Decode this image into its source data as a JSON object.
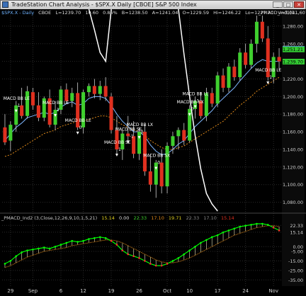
{
  "window": {
    "title": "TradeStation Chart Analysis - $SPX.X Daily [CBOE] S&P 500 Index",
    "buttons": [
      "_",
      "□",
      "✕"
    ]
  },
  "quote_bar": {
    "symbol": "$SPX.X - Daily",
    "exchange": "CBOE",
    "last": "L=1239.70",
    "change": "10.60",
    "pct": "0.86%",
    "bid": "B=1238.50",
    "ask": "A=1241.04",
    "open": "O=1229.59",
    "high": "Hi=1246.22",
    "low": "Lo=1227.70",
    "volume": "V=3,041,607",
    "study": "_PMACD_Ind1(1..."
  },
  "indicator2": {
    "title": "_PMACD_Ind2 (3,Close,12,26,9,10,1,5,21)",
    "values": [
      "15.14",
      "0.00",
      "22.33",
      "17.10",
      "19.71",
      "22.33",
      "17.10",
      "15.14"
    ]
  },
  "colors": {
    "up": "#3fcf2e",
    "down": "#e0301f",
    "ma_blue": "#7fb7ff",
    "ma_orange": "#e08a1a",
    "white_line": "#ffffff",
    "macd_green": "#00ff00",
    "macd_red": "#ff2a2a",
    "price_tag_up": "#33cc33",
    "price_tag_blue": "#5f86ff"
  },
  "chart_data": [
    {
      "type": "candlestick",
      "title": "",
      "ylim": [
        1070,
        1292
      ],
      "y_ticks": [
        1080,
        1100,
        1120,
        1140,
        1160,
        1180,
        1200,
        1220,
        1240,
        1260,
        1280
      ],
      "x_ticks": [
        "29",
        "Sep",
        "6",
        "12",
        "19",
        "26",
        "Oct",
        "10",
        "17",
        "24",
        "Nov"
      ],
      "x_tick_index": [
        1,
        5,
        10,
        14,
        19,
        24,
        29,
        33,
        38,
        43,
        48
      ],
      "last_price_tags": [
        "1,254.17",
        "1,251.21",
        "1,239.70"
      ],
      "candles": [
        [
          1165,
          1180,
          1145,
          1148
        ],
        [
          1150,
          1172,
          1138,
          1168
        ],
        [
          1168,
          1195,
          1160,
          1190
        ],
        [
          1190,
          1210,
          1175,
          1178
        ],
        [
          1178,
          1212,
          1175,
          1206
        ],
        [
          1205,
          1210,
          1185,
          1190
        ],
        [
          1190,
          1205,
          1172,
          1176
        ],
        [
          1176,
          1200,
          1172,
          1198
        ],
        [
          1198,
          1208,
          1165,
          1168
        ],
        [
          1168,
          1195,
          1162,
          1185
        ],
        [
          1185,
          1212,
          1180,
          1208
        ],
        [
          1208,
          1215,
          1192,
          1195
        ],
        [
          1195,
          1210,
          1188,
          1204
        ],
        [
          1204,
          1216,
          1162,
          1165
        ],
        [
          1165,
          1208,
          1158,
          1205
        ],
        [
          1205,
          1215,
          1200,
          1212
        ],
        [
          1212,
          1220,
          1198,
          1203
        ],
        [
          1203,
          1218,
          1196,
          1212
        ],
        [
          1212,
          1222,
          1195,
          1200
        ],
        [
          1200,
          1204,
          1158,
          1162
        ],
        [
          1162,
          1178,
          1135,
          1140
        ],
        [
          1140,
          1162,
          1128,
          1158
        ],
        [
          1158,
          1178,
          1150,
          1155
        ],
        [
          1155,
          1172,
          1130,
          1135
        ],
        [
          1135,
          1165,
          1128,
          1160
        ],
        [
          1160,
          1168,
          1110,
          1115
        ],
        [
          1115,
          1135,
          1092,
          1100
        ],
        [
          1100,
          1128,
          1085,
          1125
        ],
        [
          1125,
          1140,
          1090,
          1098
        ],
        [
          1098,
          1148,
          1090,
          1144
        ],
        [
          1144,
          1160,
          1135,
          1155
        ],
        [
          1155,
          1165,
          1140,
          1162
        ],
        [
          1162,
          1170,
          1145,
          1150
        ],
        [
          1150,
          1190,
          1148,
          1186
        ],
        [
          1186,
          1200,
          1175,
          1195
        ],
        [
          1195,
          1205,
          1175,
          1178
        ],
        [
          1178,
          1210,
          1172,
          1204
        ],
        [
          1204,
          1210,
          1188,
          1192
        ],
        [
          1192,
          1228,
          1188,
          1224
        ],
        [
          1224,
          1232,
          1205,
          1210
        ],
        [
          1210,
          1238,
          1205,
          1234
        ],
        [
          1234,
          1242,
          1218,
          1222
        ],
        [
          1222,
          1255,
          1218,
          1250
        ],
        [
          1250,
          1260,
          1232,
          1236
        ],
        [
          1236,
          1265,
          1232,
          1260
        ],
        [
          1260,
          1292,
          1250,
          1285
        ],
        [
          1285,
          1292,
          1262,
          1266
        ],
        [
          1266,
          1280,
          1218,
          1222
        ],
        [
          1222,
          1250,
          1215,
          1245
        ],
        [
          1245,
          1255,
          1230,
          1240
        ]
      ],
      "series": [
        {
          "kind": "line",
          "values": [
            1150,
            1158,
            1165,
            1170,
            1176,
            1178,
            1180,
            1182,
            1180,
            1182,
            1188,
            1192,
            1194,
            1190,
            1192,
            1198,
            1200,
            1200,
            1198,
            1190,
            1180,
            1172,
            1166,
            1160,
            1160,
            1155,
            1145,
            1138,
            1134,
            1135,
            1140,
            1146,
            1150,
            1158,
            1166,
            1172,
            1178,
            1184,
            1192,
            1198,
            1204,
            1210,
            1218,
            1225,
            1232,
            1238,
            1242,
            1240,
            1240,
            1240
          ]
        },
        {
          "kind": "dashed",
          "values": [
            1132,
            1134,
            1138,
            1142,
            1146,
            1150,
            1154,
            1158,
            1160,
            1162,
            1166,
            1168,
            1170,
            1172,
            1172,
            1174,
            1176,
            1178,
            1178,
            1176,
            1172,
            1168,
            1165,
            1162,
            1160,
            1156,
            1150,
            1146,
            1142,
            1140,
            1140,
            1142,
            1144,
            1148,
            1152,
            1156,
            1160,
            1164,
            1168,
            1172,
            1178,
            1184,
            1190,
            1195,
            1200,
            1206,
            1210,
            1214,
            1218,
            1222
          ]
        },
        {
          "kind": "white",
          "values": [
            null,
            null,
            null,
            null,
            null,
            null,
            null,
            null,
            null,
            null,
            null,
            null,
            null,
            null,
            null,
            1292,
            1276,
            1250,
            1240,
            1292,
            null,
            null,
            null,
            null,
            null,
            null,
            null,
            null,
            null,
            null,
            null,
            1292,
            1248,
            1200,
            1155,
            1118,
            1090,
            1078,
            1070
          ]
        }
      ],
      "annotations": [
        {
          "i": 2,
          "label": "MACD BB LE",
          "sign": "1"
        },
        {
          "i": 9,
          "label": "MACD BB LE",
          "sign": "1"
        },
        {
          "i": 13,
          "label": "MACD BB LE",
          "sign": "0"
        },
        {
          "i": 20,
          "label": "MACD BB SE",
          "sign": "1"
        },
        {
          "i": 22,
          "label": "MACD BB SE",
          "sign": "-1"
        },
        {
          "i": 24,
          "label": "MACD BB LX",
          "sign": "0"
        },
        {
          "i": 27,
          "label": "MACD BB SX",
          "sign": "0"
        },
        {
          "i": 34,
          "label": "MACD BB LE",
          "sign": "1"
        },
        {
          "i": 33,
          "label": "MACD BB SX",
          "sign": "0"
        },
        {
          "i": 47,
          "label": "MACD BB LE",
          "sign": "1"
        }
      ]
    },
    {
      "type": "line",
      "title": "_PMACD_Ind2 (3,Close,12,26,9,10,1,5,21)",
      "ylim": [
        -40,
        27
      ],
      "y_ticks": [
        "22.33",
        "15.14",
        "0.00",
        "-5.00",
        "-15.00",
        "-25.00",
        "-35.00"
      ],
      "series": [
        {
          "name": "MACD",
          "values": [
            -18,
            -15,
            -10,
            -6,
            -4,
            -3,
            -2,
            -1,
            -2,
            0,
            2,
            4,
            6,
            5,
            6,
            8,
            9,
            10,
            9,
            6,
            2,
            -4,
            -8,
            -10,
            -12,
            -15,
            -18,
            -20,
            -20,
            -18,
            -15,
            -12,
            -8,
            -4,
            0,
            4,
            7,
            10,
            12,
            15,
            17,
            19,
            21,
            22,
            23,
            24,
            24,
            23,
            20,
            17
          ]
        },
        {
          "name": "Signal",
          "values": [
            -22,
            -20,
            -17,
            -14,
            -11,
            -9,
            -7,
            -5,
            -4,
            -3,
            -2,
            -1,
            1,
            2,
            3,
            4,
            5,
            6,
            7,
            7,
            6,
            4,
            1,
            -2,
            -5,
            -8,
            -11,
            -14,
            -16,
            -17,
            -17,
            -16,
            -14,
            -12,
            -9,
            -6,
            -3,
            0,
            3,
            6,
            9,
            12,
            14,
            16,
            18,
            20,
            21,
            22,
            22,
            21
          ]
        }
      ]
    }
  ]
}
